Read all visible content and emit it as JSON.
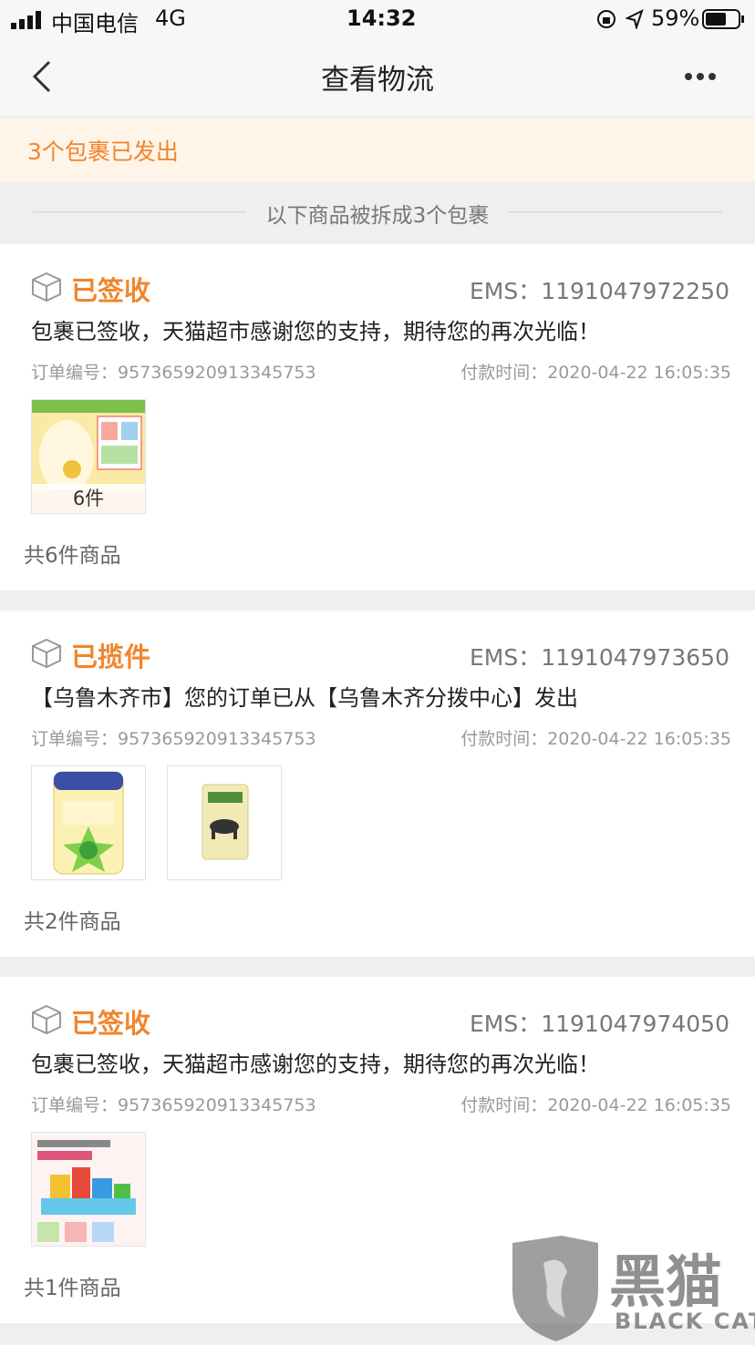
{
  "statusbar": {
    "carrier": "中国电信",
    "network": "4G",
    "time": "14:32",
    "battery": "59%"
  },
  "nav": {
    "title": "查看物流"
  },
  "banner": {
    "text": "3个包裹已发出"
  },
  "split_note": "以下商品被拆成3个包裹",
  "packages": [
    {
      "status": "已签收",
      "ems": "EMS：1191047972250",
      "message": "包裹已签收，天猫超市感谢您的支持，期待您的再次光临！",
      "order": "订单编号：957365920913345753",
      "paid": "付款时间：2020-04-22 16:05:35",
      "thumb_qty": "6件",
      "count": "共6件商品"
    },
    {
      "status": "已揽件",
      "ems": "EMS：1191047973650",
      "message": "【乌鲁木齐市】您的订单已从【乌鲁木齐分拨中心】发出",
      "order": "订单编号：957365920913345753",
      "paid": "付款时间：2020-04-22 16:05:35",
      "count": "共2件商品"
    },
    {
      "status": "已签收",
      "ems": "EMS：1191047974050",
      "message": "包裹已签收，天猫超市感谢您的支持，期待您的再次光临！",
      "order": "订单编号：957365920913345753",
      "paid": "付款时间：2020-04-22 16:05:35",
      "count": "共1件商品"
    }
  ],
  "colors": {
    "accent": "#f0862c",
    "banner_bg": "#fff4e8"
  },
  "watermark": {
    "cn": "黑猫",
    "en": "BLACK CAT"
  }
}
